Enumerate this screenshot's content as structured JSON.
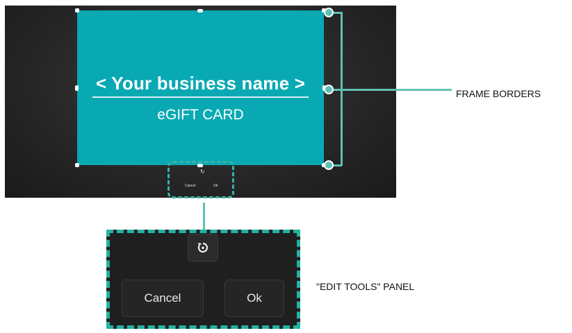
{
  "card": {
    "title": "< Your business name >",
    "subtitle": "eGIFT CARD",
    "color": "#08a9b3"
  },
  "edit_tools": {
    "rotate_icon": "rotate-icon",
    "cancel_label": "Cancel",
    "ok_label": "Ok"
  },
  "callouts": {
    "frame_borders": "FRAME BORDERS",
    "edit_tools_panel": "\"EDIT TOOLS\" PANEL",
    "accent": "#5fc1b4"
  }
}
